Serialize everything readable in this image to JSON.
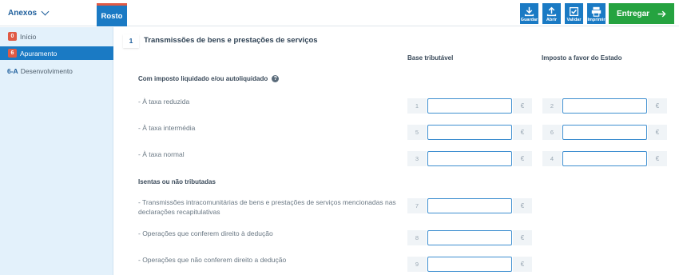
{
  "header": {
    "anexos_label": "Anexos",
    "tab_label": "Rosto",
    "actions": [
      {
        "label": "Guardar",
        "icon": "download-icon"
      },
      {
        "label": "Abrir",
        "icon": "upload-icon"
      },
      {
        "label": "Validar",
        "icon": "check-icon"
      },
      {
        "label": "Imprimir",
        "icon": "printer-icon"
      }
    ],
    "submit_label": "Entregar"
  },
  "sidebar": {
    "items": [
      {
        "badge": "0",
        "label": "Início"
      },
      {
        "badge": "6",
        "label": "Apuramento"
      },
      {
        "code": "6-A",
        "label": "Desenvolvimento"
      }
    ]
  },
  "section": {
    "number": "1",
    "title": "Transmissões de bens e prestações de serviços",
    "col_base": "Base tributável",
    "col_imposto": "Imposto a favor do Estado",
    "group1": "Com imposto liquidado e/ou autoliquidado",
    "group2": "Isentas ou não tributadas",
    "rows": [
      {
        "label": "- À taxa reduzida",
        "base_num": "1",
        "imposto_num": "2"
      },
      {
        "label": "- À taxa intermédia",
        "base_num": "5",
        "imposto_num": "6"
      },
      {
        "label": "- À taxa normal",
        "base_num": "3",
        "imposto_num": "4"
      },
      {
        "label": "- Transmissões intracomunitárias de bens e prestações de serviços mencionadas nas declarações recapitulativas",
        "base_num": "7"
      },
      {
        "label": "- Operações que conferem direito à dedução",
        "base_num": "8"
      },
      {
        "label": "- Operações que não conferem direito a dedução",
        "base_num": "9"
      }
    ],
    "currency": "€"
  },
  "colors": {
    "accent": "#1a7ac4",
    "badge": "#e05a45",
    "submit": "#25a340",
    "sidebar_bg": "#e3f1fb"
  }
}
